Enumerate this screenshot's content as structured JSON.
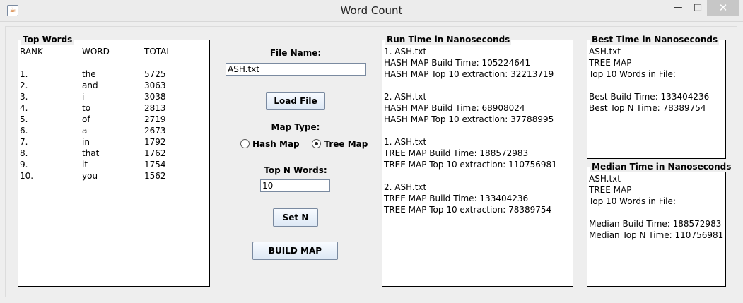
{
  "window": {
    "title": "Word Count",
    "icon": "java-cup-icon",
    "minimize_glyph": "—",
    "maximize_glyph": "□",
    "close_glyph": "✕"
  },
  "top_words": {
    "legend": "Top Words",
    "headers": {
      "rank": "RANK",
      "word": "WORD",
      "total": "TOTAL"
    },
    "rows": [
      {
        "rank": "1.",
        "word": "the",
        "total": "5725"
      },
      {
        "rank": "2.",
        "word": "and",
        "total": "3063"
      },
      {
        "rank": "3.",
        "word": "i",
        "total": "3038"
      },
      {
        "rank": "4.",
        "word": "to",
        "total": "2813"
      },
      {
        "rank": "5.",
        "word": "of",
        "total": "2719"
      },
      {
        "rank": "6.",
        "word": "a",
        "total": "2673"
      },
      {
        "rank": "7.",
        "word": "in",
        "total": "1792"
      },
      {
        "rank": "8.",
        "word": "that",
        "total": "1762"
      },
      {
        "rank": "9.",
        "word": "it",
        "total": "1754"
      },
      {
        "rank": "10.",
        "word": "you",
        "total": "1562"
      }
    ]
  },
  "controls": {
    "file_name_label": "File Name:",
    "file_name_value": "ASH.txt",
    "load_button": "Load File",
    "map_type_label": "Map Type:",
    "hash_map_label": "Hash Map",
    "tree_map_label": "Tree Map",
    "selected_map": "tree",
    "top_n_label": "Top N Words:",
    "top_n_value": "10",
    "set_n_button": "Set N",
    "build_button": "BUILD MAP"
  },
  "run_time": {
    "legend": "Run Time in Nanoseconds",
    "lines": [
      "1. ASH.txt",
      "HASH MAP Build Time: 105224641",
      "HASH MAP Top 10 extraction:  32213719",
      "",
      "2. ASH.txt",
      "HASH MAP Build Time: 68908024",
      "HASH MAP Top 10 extraction:  37788995",
      "",
      "1. ASH.txt",
      "TREE MAP Build Time: 188572983",
      "TREE MAP Top 10 extraction:  110756981",
      "",
      "2. ASH.txt",
      "TREE MAP Build Time: 133404236",
      "TREE MAP Top 10 extraction:  78389754"
    ]
  },
  "best_time": {
    "legend": "Best Time in Nanoseconds",
    "lines": [
      "ASH.txt",
      "TREE MAP",
      "Top 10 Words in File:",
      "",
      "Best Build Time: 133404236",
      "Best Top N Time: 78389754"
    ]
  },
  "median_time": {
    "legend": "Median Time in Nanoseconds",
    "lines": [
      "ASH.txt",
      "TREE MAP",
      "Top 10 Words in File:",
      "",
      "Median Build Time: 188572983",
      "Median Top N Time: 110756981"
    ]
  }
}
